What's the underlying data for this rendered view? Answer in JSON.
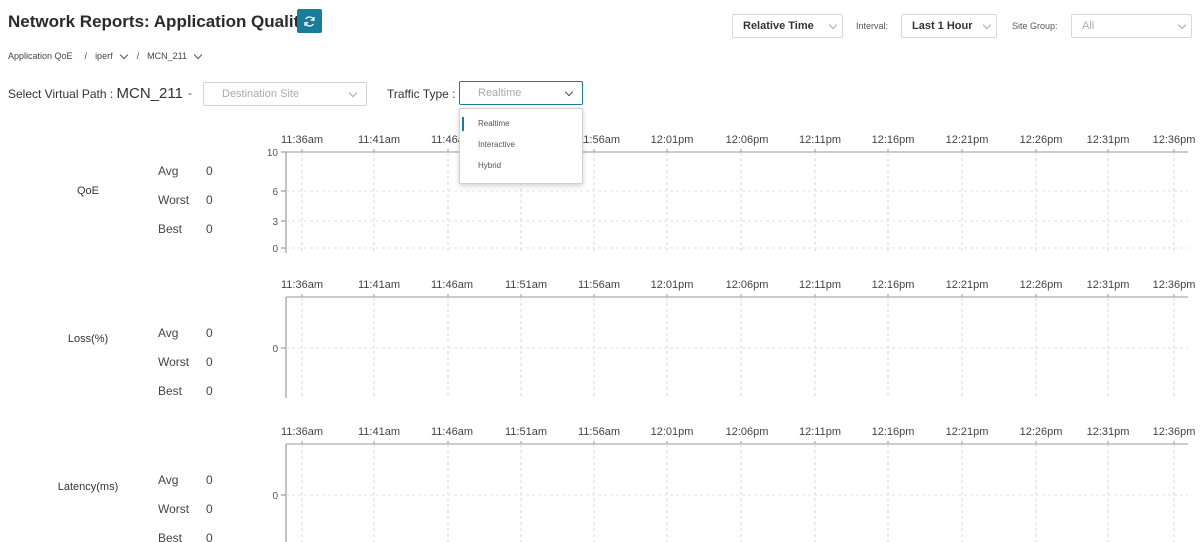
{
  "header": {
    "title": "Network Reports: Application Quality",
    "time_mode": "Relative Time",
    "interval_label": "Interval:",
    "interval_value": "Last 1 Hour",
    "site_group_label": "Site Group:",
    "site_group_value": "All"
  },
  "breadcrumb": {
    "root": "Application QoE",
    "sep1": "/",
    "item1": "iperf",
    "sep2": "/",
    "item2": "MCN_211"
  },
  "filters": {
    "virtual_path_label": "Select Virtual Path : ",
    "virtual_path_value": "MCN_211",
    "dash": "-",
    "destination_placeholder": "Destination Site",
    "traffic_type_label": "Traffic Type :",
    "traffic_type_value": "Realtime",
    "traffic_type_options": [
      "Realtime",
      "Interactive",
      "Hybrid"
    ]
  },
  "time_ticks": [
    "11:36am",
    "11:41am",
    "11:46am",
    "11:51am",
    "11:56am",
    "12:01pm",
    "12:06pm",
    "12:11pm",
    "12:16pm",
    "12:21pm",
    "12:26pm",
    "12:31pm",
    "12:36pm"
  ],
  "stat_labels": {
    "avg": "Avg",
    "worst": "Worst",
    "best": "Best"
  },
  "metrics": [
    {
      "name": "QoE",
      "avg": "0",
      "worst": "0",
      "best": "0",
      "y_ticks": [
        "10",
        "6",
        "3",
        "0"
      ]
    },
    {
      "name": "Loss(%)",
      "avg": "0",
      "worst": "0",
      "best": "0",
      "y_ticks": [
        "0"
      ]
    },
    {
      "name": "Latency(ms)",
      "avg": "0",
      "worst": "0",
      "best": "0",
      "y_ticks": [
        "0"
      ]
    }
  ],
  "colors": {
    "accent": "#1a7c99",
    "grid": "#d6d6d6",
    "axis": "#888888"
  }
}
